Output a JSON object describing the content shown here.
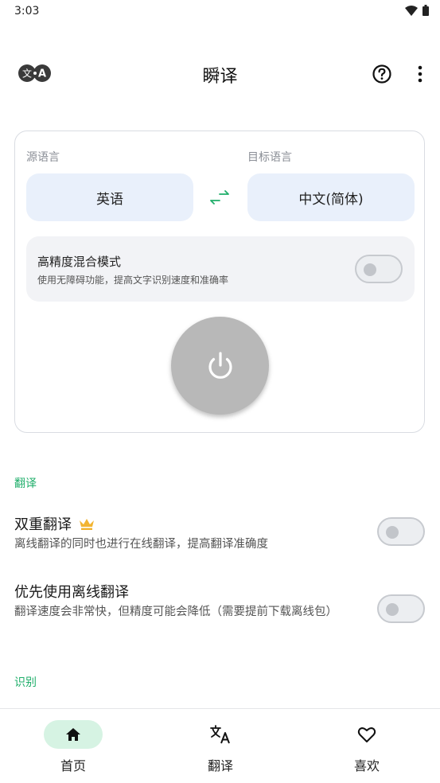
{
  "status_bar": {
    "time": "3:03",
    "icons": [
      "wifi-icon",
      "battery-icon"
    ]
  },
  "app_bar": {
    "title": "瞬译",
    "left_icon": "language-translate-icon",
    "left_icon_letters": [
      "文",
      "A"
    ],
    "right_icons": [
      "help-icon",
      "more-vert-icon"
    ]
  },
  "translator_card": {
    "source_label": "源语言",
    "target_label": "目标语言",
    "source_language": "英语",
    "target_language": "中文(简体)",
    "swap_icon": "swap-icon",
    "hq_mode": {
      "title": "高精度混合模式",
      "subtitle": "使用无障碍功能，提高文字识别速度和准确率",
      "enabled": false
    },
    "power_icon": "power-icon",
    "power_on": false
  },
  "sections": {
    "translate": {
      "title": "翻译",
      "items": [
        {
          "title": "双重翻译",
          "badge_icon": "crown-icon",
          "subtitle": "离线翻译的同时也进行在线翻译，提高翻译准确度",
          "enabled": false
        },
        {
          "title": "优先使用离线翻译",
          "subtitle": "翻译速度会非常快，但精度可能会降低（需要提前下载离线包）",
          "enabled": false
        }
      ]
    },
    "recognize": {
      "title": "识别"
    }
  },
  "bottom_nav": {
    "items": [
      {
        "label": "首页",
        "icon": "home-icon",
        "active": true
      },
      {
        "label": "翻译",
        "icon": "translate-icon",
        "active": false
      },
      {
        "label": "喜欢",
        "icon": "heart-icon",
        "active": false
      }
    ]
  },
  "colors": {
    "accent_green": "#1fae6a",
    "lang_button_bg": "#e9f0fb",
    "power_button": "#b8b8b8",
    "crown": "#f2b431",
    "nav_active_pill": "#d6f3e3"
  }
}
